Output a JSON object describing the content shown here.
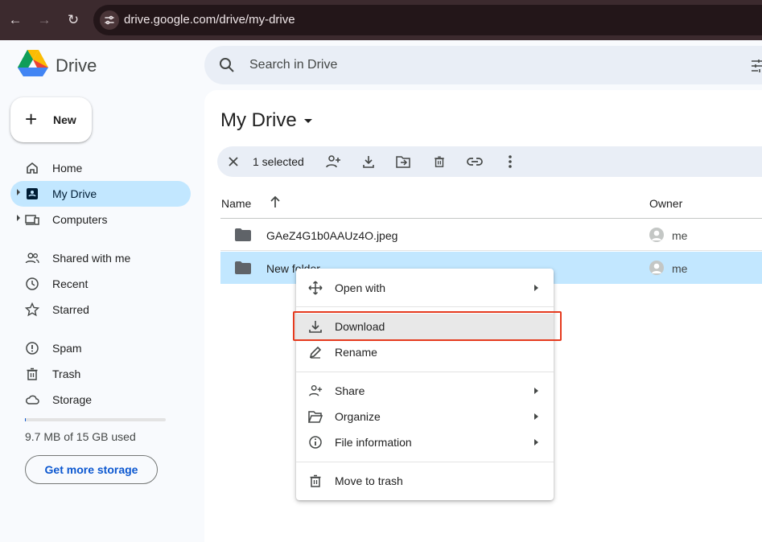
{
  "browser": {
    "url": "drive.google.com/drive/my-drive"
  },
  "app": {
    "name": "Drive",
    "new_label": "New"
  },
  "sidebar": {
    "items": [
      {
        "label": "Home",
        "icon": "home-icon"
      },
      {
        "label": "My Drive",
        "icon": "my-drive-icon",
        "active": true
      },
      {
        "label": "Computers",
        "icon": "computers-icon"
      },
      {
        "label": "Shared with me",
        "icon": "shared-icon"
      },
      {
        "label": "Recent",
        "icon": "clock-icon"
      },
      {
        "label": "Starred",
        "icon": "star-icon"
      },
      {
        "label": "Spam",
        "icon": "spam-icon"
      },
      {
        "label": "Trash",
        "icon": "trash-icon"
      },
      {
        "label": "Storage",
        "icon": "cloud-icon"
      }
    ],
    "storage_used_fraction": 0.0006,
    "storage_text": "9.7 MB of 15 GB used",
    "storage_button": "Get more storage"
  },
  "search": {
    "placeholder": "Search in Drive"
  },
  "main": {
    "title": "My Drive",
    "selection": {
      "count_label": "1 selected"
    },
    "columns": {
      "name": "Name",
      "owner": "Owner"
    },
    "rows": [
      {
        "name": "GAeZ4G1b0AAUz4O.jpeg",
        "owner": "me",
        "selected": false
      },
      {
        "name": "New folder",
        "owner": "me",
        "selected": true
      }
    ]
  },
  "context_menu": {
    "items": [
      {
        "label": "Open with",
        "icon": "move-icon",
        "submenu": true
      },
      {
        "label": "Download",
        "icon": "download-icon",
        "submenu": false,
        "highlighted": true
      },
      {
        "label": "Rename",
        "icon": "rename-icon",
        "submenu": false
      },
      {
        "label": "Share",
        "icon": "share-icon",
        "submenu": true
      },
      {
        "label": "Organize",
        "icon": "folder-open-icon",
        "submenu": true
      },
      {
        "label": "File information",
        "icon": "info-icon",
        "submenu": true
      },
      {
        "label": "Move to trash",
        "icon": "trash-icon",
        "submenu": false
      }
    ]
  },
  "colors": {
    "accent": "#0b57d0",
    "selected_bg": "#c2e7ff",
    "highlight_border": "#e53a1e"
  }
}
